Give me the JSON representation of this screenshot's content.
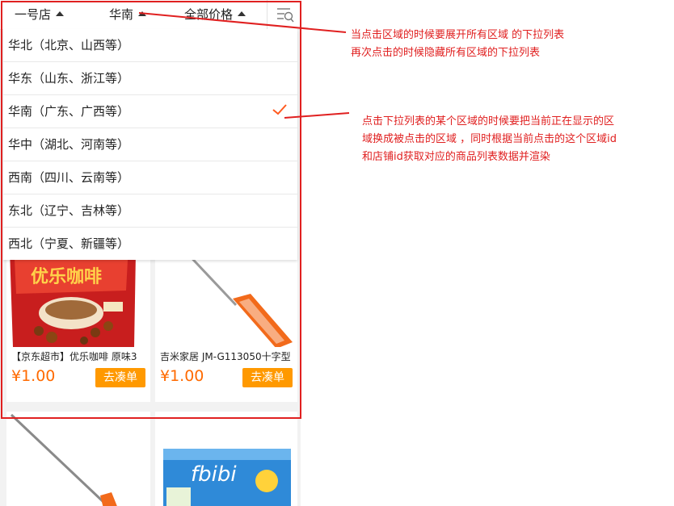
{
  "topbar": {
    "store": "一号店",
    "region": "华南",
    "price": "全部价格",
    "filter_icon": "filter-list-icon"
  },
  "dropdown": {
    "items": [
      {
        "label": "华北（北京、山西等）"
      },
      {
        "label": "华东（山东、浙江等）"
      },
      {
        "label": "华南（广东、广西等）",
        "selected": true
      },
      {
        "label": "华中（湖北、河南等）"
      },
      {
        "label": "西南（四川、云南等）"
      },
      {
        "label": "东北（辽宁、吉林等）"
      },
      {
        "label": "西北（宁夏、新疆等）"
      }
    ]
  },
  "products": [
    {
      "title": "【京东超市】优乐咖啡 原味3",
      "price": "¥1.00",
      "button": "去凑单",
      "image_text": "优乐咖啡"
    },
    {
      "title": "吉米家居 JM-G113050十字型",
      "price": "¥1.00",
      "button": "去凑单"
    },
    {
      "title": "",
      "price": "",
      "button": ""
    },
    {
      "title": "",
      "price": "",
      "button": "",
      "image_text": "五羊 fbibi"
    }
  ],
  "annotations": {
    "note1_line1": "当点击区域的时候要展开所有区域 的下拉列表",
    "note1_line2": "再次点击的时候隐藏所有区域的下拉列表",
    "note2_line1": "点击下拉列表的某个区域的时候要把当前正在显示的区",
    "note2_line2": "域换成被点击的区域 ，同时根据当前点击的这个区域id",
    "note2_line3": "和店铺id获取对应的商品列表数据并渲染"
  },
  "colors": {
    "accent_red": "#e02020",
    "price_orange": "#ff6a00",
    "button_orange": "#ff9900",
    "check_orange": "#ff5a1f"
  }
}
